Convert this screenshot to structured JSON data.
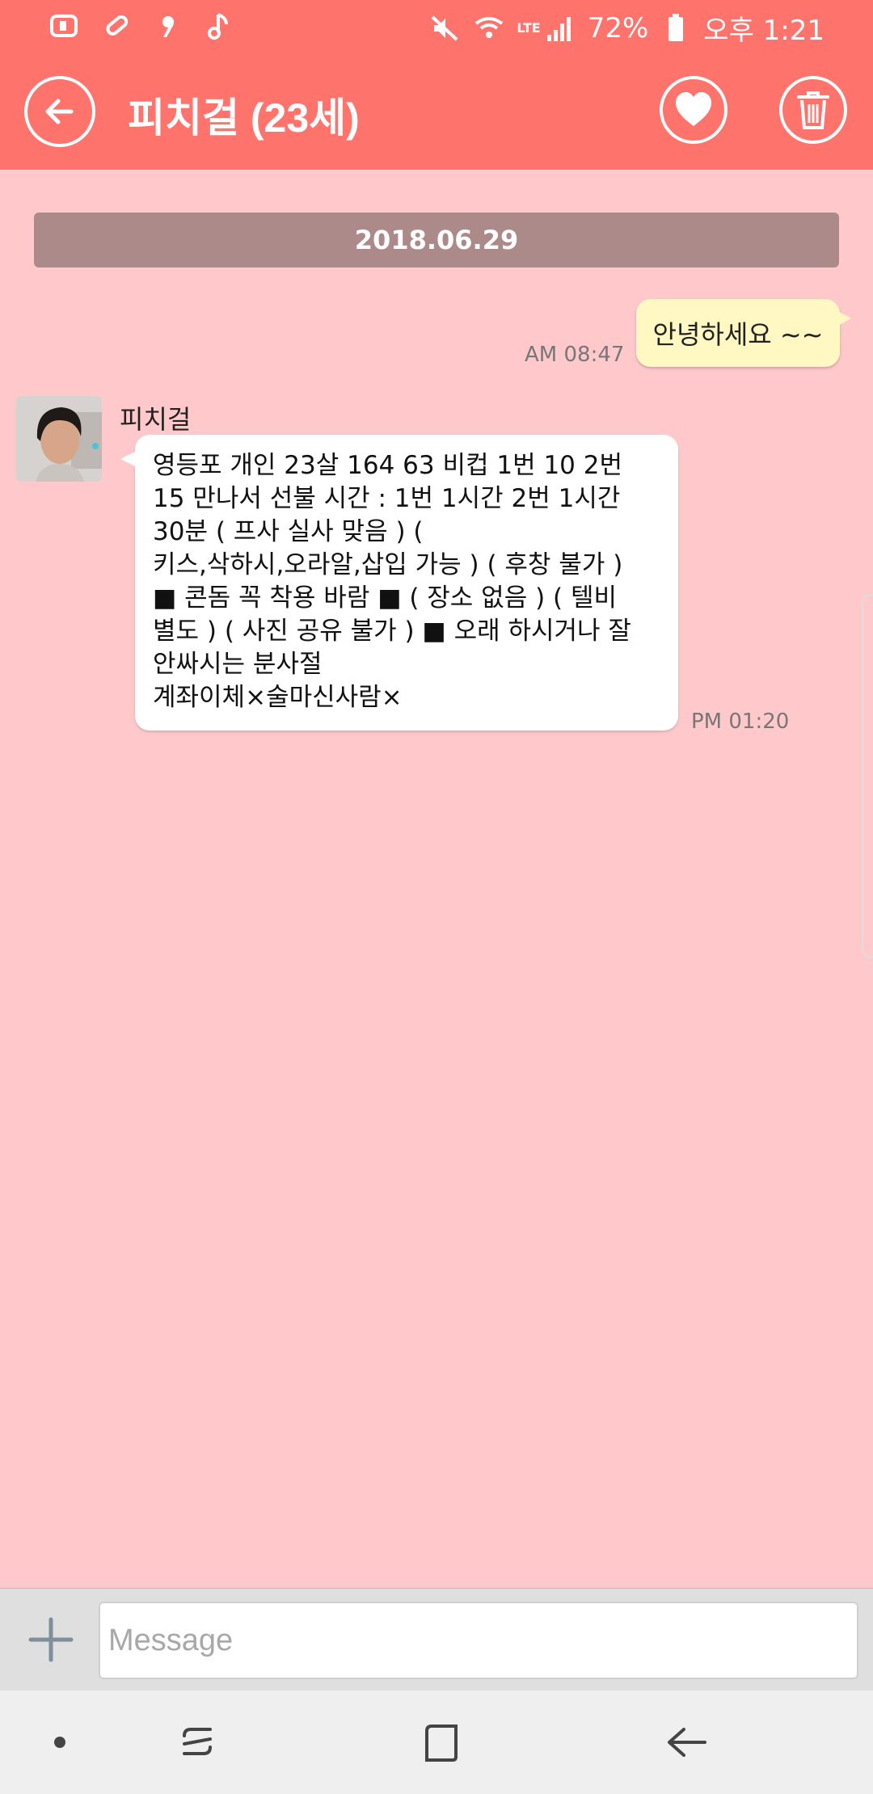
{
  "status_bar": {
    "battery": "72%",
    "time": "오후 1:21",
    "network": "LTE"
  },
  "header": {
    "title": "피치걸 (23세)"
  },
  "chat": {
    "date": "2018.06.29",
    "sent": {
      "text": "안녕하세요 ~~",
      "time": "AM 08:47"
    },
    "received": {
      "sender": "피치걸",
      "lines": [
        "영등포 개인 23살 164 63 비컵 1번 10 2번",
        "15 만나서 선불 시간 : 1번 1시간 2번 1시간",
        "30분 ( 프사 실사 맞음 ) (",
        "키스,삭하시,오라알,삽입 가능 ) ( 후창 불가 )",
        "■ 콘돔 꼭 착용 바람 ■ ( 장소 없음 ) ( 텔비",
        "별도 ) ( 사진 공유 불가 ) ■ 오래 하시거나 잘",
        "안싸시는 분사절",
        "계좌이체×술마신사람×"
      ],
      "time": "PM 01:20"
    }
  },
  "composer": {
    "placeholder": "Message"
  },
  "colors": {
    "accent": "#ff736d",
    "background": "#ffc9cc",
    "sent_bubble": "#fff8c2",
    "date_bar": "#ad8a8a"
  },
  "icons": {
    "back": "arrow-left-icon",
    "favorite": "heart-icon",
    "delete": "trash-icon",
    "attach": "plus-icon"
  }
}
